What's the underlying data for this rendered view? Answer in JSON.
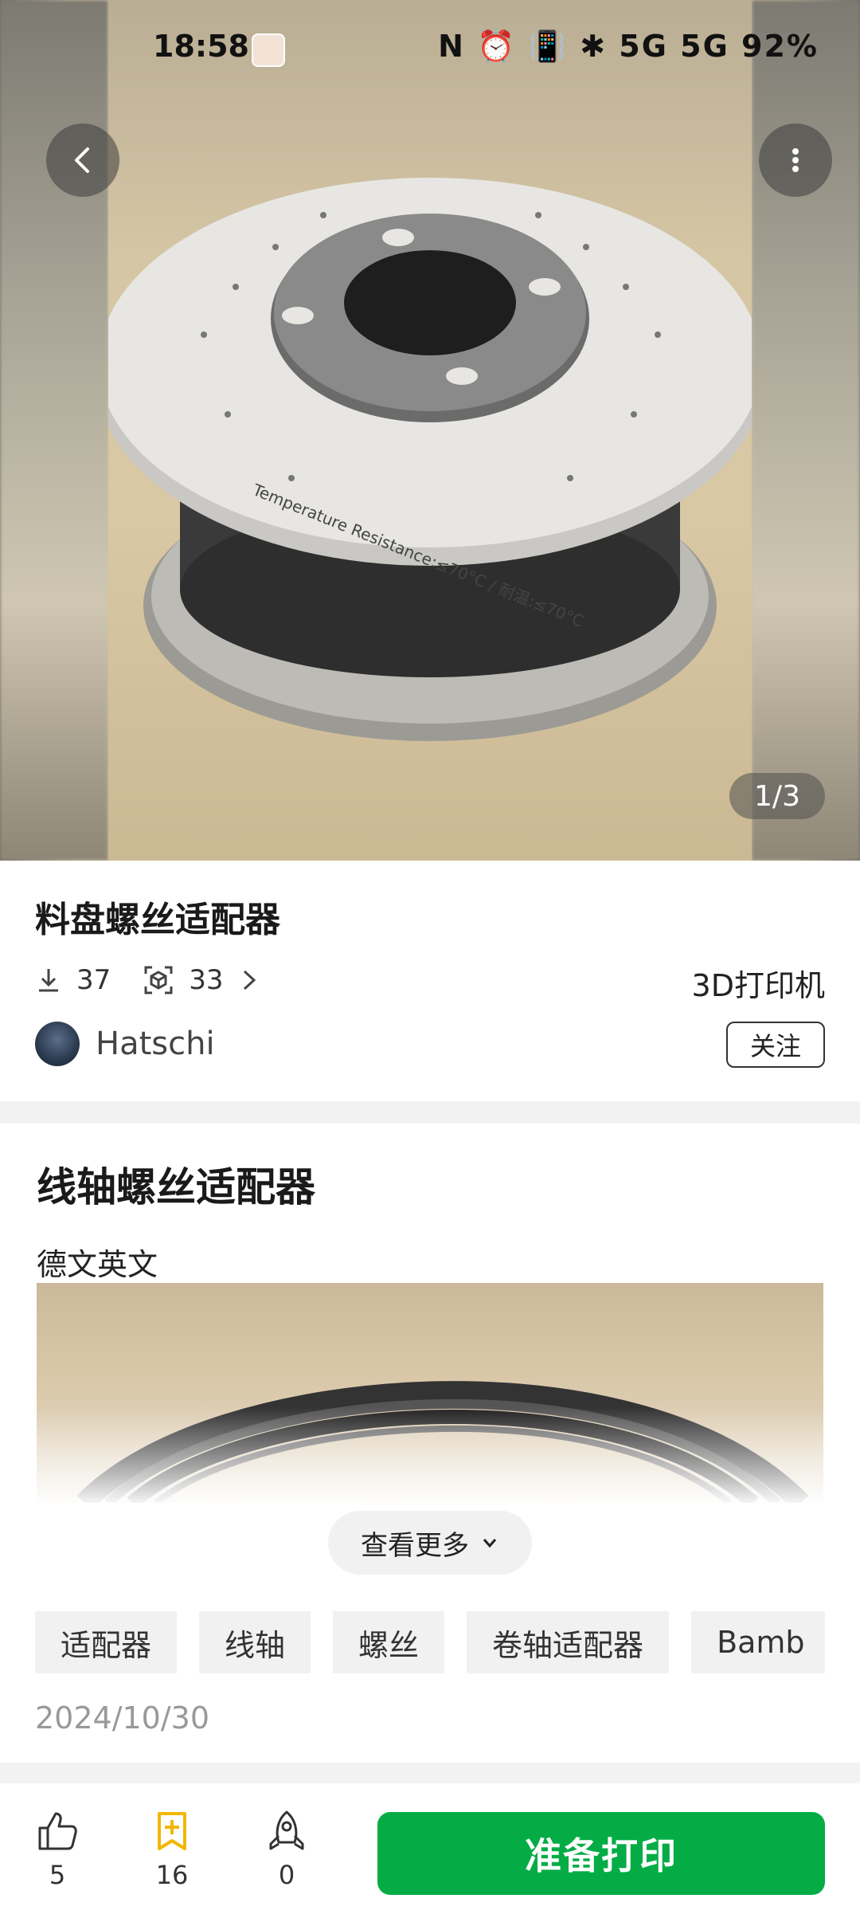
{
  "status_bar": {
    "time": "18:58",
    "icons": "N ⏰ 📳 ✱ 5G 5G",
    "battery": "92%"
  },
  "hero": {
    "page_counter": "1/3",
    "spool_text": "Temperature Resistance:≤70°C / 耐温:≤70°C"
  },
  "model": {
    "title": "料盘螺丝适配器",
    "downloads": "37",
    "prints": "33",
    "category": "3D打印机"
  },
  "author": {
    "name": "Hatschi",
    "follow_label": "关注"
  },
  "description": {
    "heading": "线轴螺丝适配器",
    "text": "德文英文",
    "see_more_label": "查看更多"
  },
  "tags": [
    "适配器",
    "线轴",
    "螺丝",
    "卷轴适配器",
    "Bamb"
  ],
  "date": "2024/10/30",
  "bottom_bar": {
    "likes": "5",
    "favorites": "16",
    "prints": "0",
    "print_button_label": "准备打印"
  },
  "colors": {
    "accent_green": "#05ac46",
    "favorite_yellow": "#f2b705"
  }
}
